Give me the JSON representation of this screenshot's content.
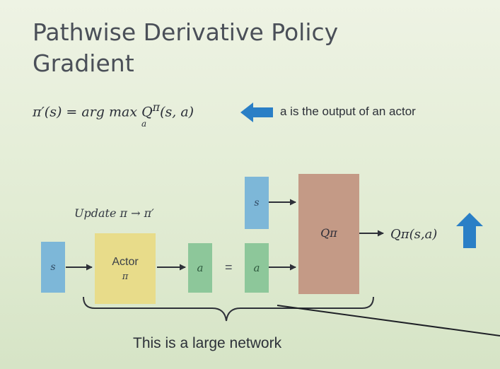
{
  "slide": {
    "title_line1": "Pathwise Derivative Policy",
    "title_line2": "Gradient"
  },
  "formula": {
    "main": "π′(s) = arg max Q",
    "superscript": "π",
    "args": "(s, a)",
    "subscript": "a"
  },
  "note": "a is the output of an actor",
  "diagram": {
    "update_label": "Update π → π′",
    "input_s_left": "s",
    "actor_label": "Actor",
    "actor_sub": "π",
    "output_a": "a",
    "equals": "=",
    "input_a_q": "a",
    "input_s_q": "s",
    "q_label": "Qπ",
    "q_output": "Qπ(s,a)",
    "caption": "This is a large network"
  },
  "colors": {
    "state_box": "#7db7d8",
    "action_box": "#8dc79a",
    "actor_box": "#e8dc8a",
    "q_box": "#c49a86",
    "arrow_blue": "#2a7fc6"
  }
}
